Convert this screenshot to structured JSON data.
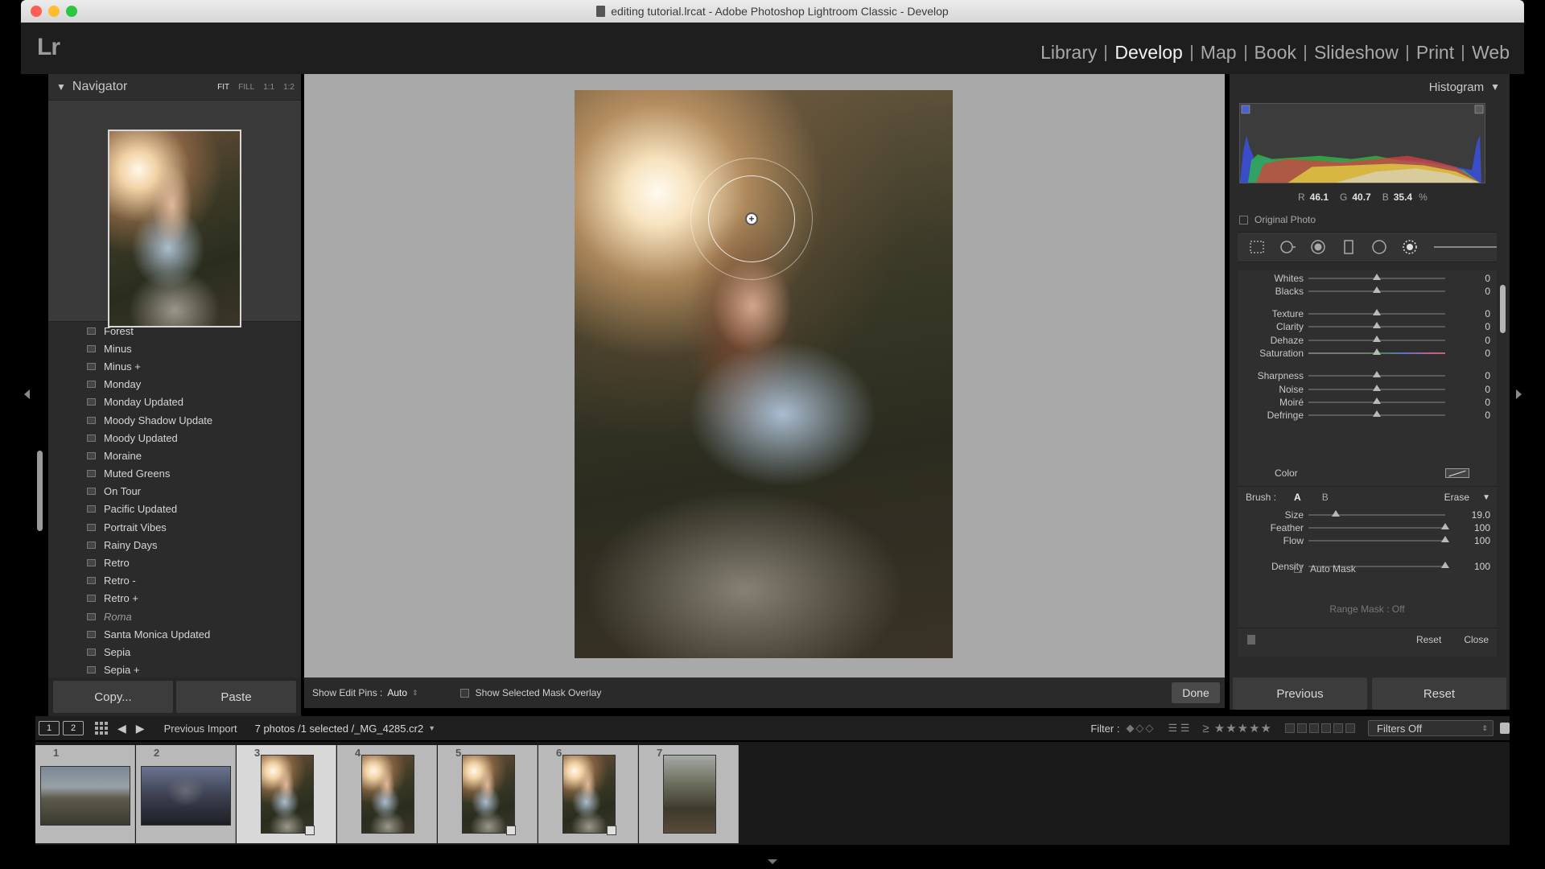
{
  "window": {
    "title": "editing tutorial.lrcat - Adobe Photoshop Lightroom Classic - Develop"
  },
  "app": {
    "logo": "Lr",
    "modules": [
      {
        "label": "Library",
        "active": false
      },
      {
        "label": "Develop",
        "active": true
      },
      {
        "label": "Map",
        "active": false
      },
      {
        "label": "Book",
        "active": false
      },
      {
        "label": "Slideshow",
        "active": false
      },
      {
        "label": "Print",
        "active": false
      },
      {
        "label": "Web",
        "active": false
      }
    ]
  },
  "navigator": {
    "title": "Navigator",
    "zoom_options": [
      "FIT",
      "FILL",
      "1:1",
      "1:2"
    ],
    "zoom_selected": "FIT"
  },
  "presets": [
    {
      "name": "Forest",
      "italic": false
    },
    {
      "name": "Minus",
      "italic": false
    },
    {
      "name": "Minus +",
      "italic": false
    },
    {
      "name": "Monday",
      "italic": false
    },
    {
      "name": "Monday Updated",
      "italic": false
    },
    {
      "name": "Moody Shadow Update",
      "italic": false
    },
    {
      "name": "Moody Updated",
      "italic": false
    },
    {
      "name": "Moraine",
      "italic": false
    },
    {
      "name": "Muted Greens",
      "italic": false
    },
    {
      "name": "On Tour",
      "italic": false
    },
    {
      "name": "Pacific Updated",
      "italic": false
    },
    {
      "name": "Portrait Vibes",
      "italic": false
    },
    {
      "name": "Rainy Days",
      "italic": false
    },
    {
      "name": "Retro",
      "italic": false
    },
    {
      "name": "Retro -",
      "italic": false
    },
    {
      "name": "Retro +",
      "italic": false
    },
    {
      "name": "Roma",
      "italic": true
    },
    {
      "name": "Santa Monica Updated",
      "italic": false
    },
    {
      "name": "Sepia",
      "italic": false
    },
    {
      "name": "Sepia +",
      "italic": false
    }
  ],
  "left_buttons": {
    "copy": "Copy...",
    "paste": "Paste"
  },
  "toolbar": {
    "edit_pins_label": "Show Edit Pins :",
    "edit_pins_value": "Auto",
    "mask_overlay_label": "Show Selected Mask Overlay",
    "done": "Done"
  },
  "histogram": {
    "title": "Histogram",
    "r_label": "R",
    "r_value": "46.1",
    "g_label": "G",
    "g_value": "40.7",
    "b_label": "B",
    "b_value": "35.4",
    "percent": "%",
    "original_photo": "Original Photo"
  },
  "sliders": [
    {
      "label": "Whites",
      "value": "0",
      "pos": 0.5
    },
    {
      "label": "Blacks",
      "value": "0",
      "pos": 0.5
    },
    {
      "label": "Texture",
      "value": "0",
      "pos": 0.5
    },
    {
      "label": "Clarity",
      "value": "0",
      "pos": 0.5
    },
    {
      "label": "Dehaze",
      "value": "0",
      "pos": 0.5
    },
    {
      "label": "Saturation",
      "value": "0",
      "pos": 0.5
    },
    {
      "label": "Sharpness",
      "value": "0",
      "pos": 0.5
    },
    {
      "label": "Noise",
      "value": "0",
      "pos": 0.5
    },
    {
      "label": "Moiré",
      "value": "0",
      "pos": 0.5
    },
    {
      "label": "Defringe",
      "value": "0",
      "pos": 0.5
    }
  ],
  "color_label": "Color",
  "brush": {
    "label": "Brush :",
    "a": "A",
    "b": "B",
    "erase": "Erase",
    "size_label": "Size",
    "size_value": "19.0",
    "size_pos": 0.2,
    "feather_label": "Feather",
    "feather_value": "100",
    "feather_pos": 1.0,
    "flow_label": "Flow",
    "flow_value": "100",
    "flow_pos": 1.0,
    "automask": "Auto Mask",
    "density_label": "Density",
    "density_value": "100",
    "density_pos": 1.0
  },
  "range_mask": "Range Mask : Off",
  "panel_footer": {
    "reset": "Reset",
    "close": "Close"
  },
  "right_buttons": {
    "previous": "Previous",
    "reset": "Reset"
  },
  "filmstrip_bar": {
    "monitor1": "1",
    "monitor2": "2",
    "source": "Previous Import",
    "info": "7 photos /1 selected /_MG_4285.cr2",
    "filter_label": "Filter :",
    "filters_off": "Filters Off"
  },
  "filmstrip": [
    {
      "num": "1",
      "kind": "land-mtn",
      "selected": false,
      "edited": false
    },
    {
      "num": "2",
      "kind": "land-temple",
      "selected": false,
      "edited": false
    },
    {
      "num": "3",
      "kind": "port",
      "selected": true,
      "edited": true
    },
    {
      "num": "4",
      "kind": "port",
      "selected": false,
      "edited": false
    },
    {
      "num": "5",
      "kind": "port",
      "selected": false,
      "edited": true
    },
    {
      "num": "6",
      "kind": "port",
      "selected": false,
      "edited": true
    },
    {
      "num": "7",
      "kind": "land-forest-port",
      "selected": false,
      "edited": false
    }
  ]
}
